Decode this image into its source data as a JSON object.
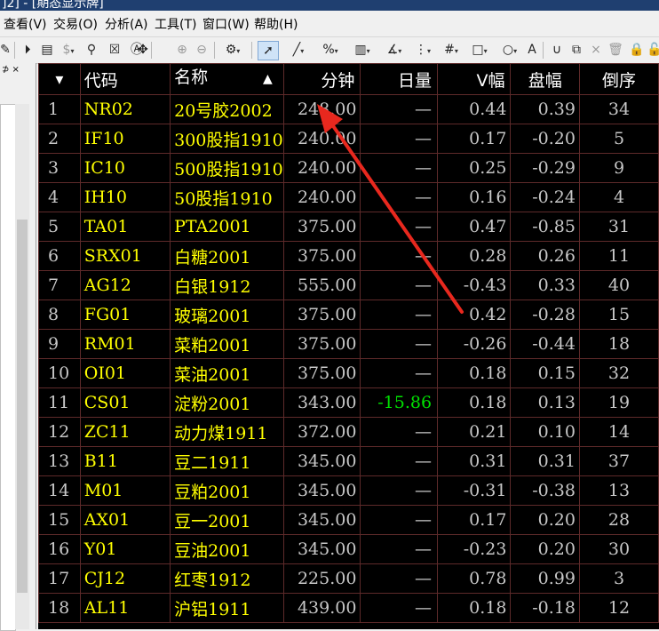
{
  "window": {
    "title_fragment": "]2] - [期态显示牌]"
  },
  "menu": [
    {
      "label": "查看(V)"
    },
    {
      "label": "交易(O)"
    },
    {
      "label": "分析(A)"
    },
    {
      "label": "工具(T)"
    },
    {
      "label": "窗口(W)"
    },
    {
      "label": "帮助(H)"
    }
  ],
  "left_panel": {
    "pin": "⊅ ×"
  },
  "table": {
    "columns": [
      "",
      "代码",
      "名称",
      "分钟",
      "日量",
      "V幅",
      "盘幅",
      "倒序"
    ],
    "sort_indicator": "▲",
    "menu_glyph": "▾",
    "rows": [
      {
        "idx": "1",
        "code": "NR02",
        "name": "20号胶2002",
        "minute": "248.00",
        "volume": "—",
        "vamp": "0.44",
        "pamp": "0.39",
        "rev": "34"
      },
      {
        "idx": "2",
        "code": "IF10",
        "name": "300股指1910",
        "minute": "240.00",
        "volume": "—",
        "vamp": "0.17",
        "pamp": "-0.20",
        "rev": "5"
      },
      {
        "idx": "3",
        "code": "IC10",
        "name": "500股指1910",
        "minute": "240.00",
        "volume": "—",
        "vamp": "0.25",
        "pamp": "-0.29",
        "rev": "9"
      },
      {
        "idx": "4",
        "code": "IH10",
        "name": "50股指1910",
        "minute": "240.00",
        "volume": "—",
        "vamp": "0.16",
        "pamp": "-0.24",
        "rev": "4"
      },
      {
        "idx": "5",
        "code": "TA01",
        "name": "PTA2001",
        "minute": "375.00",
        "volume": "—",
        "vamp": "0.47",
        "pamp": "-0.85",
        "rev": "31"
      },
      {
        "idx": "6",
        "code": "SRX01",
        "name": "白糖2001",
        "minute": "375.00",
        "volume": "—",
        "vamp": "0.28",
        "pamp": "0.26",
        "rev": "11"
      },
      {
        "idx": "7",
        "code": "AG12",
        "name": "白银1912",
        "minute": "555.00",
        "volume": "—",
        "vamp": "-0.43",
        "pamp": "0.33",
        "rev": "40"
      },
      {
        "idx": "8",
        "code": "FG01",
        "name": "玻璃2001",
        "minute": "375.00",
        "volume": "—",
        "vamp": "0.42",
        "pamp": "-0.28",
        "rev": "15"
      },
      {
        "idx": "9",
        "code": "RM01",
        "name": "菜粕2001",
        "minute": "375.00",
        "volume": "—",
        "vamp": "-0.26",
        "pamp": "-0.44",
        "rev": "18"
      },
      {
        "idx": "10",
        "code": "OI01",
        "name": "菜油2001",
        "minute": "375.00",
        "volume": "—",
        "vamp": "0.18",
        "pamp": "0.15",
        "rev": "32"
      },
      {
        "idx": "11",
        "code": "CS01",
        "name": "淀粉2001",
        "minute": "343.00",
        "volume": "-15.86",
        "vamp": "0.18",
        "pamp": "0.13",
        "rev": "19",
        "volume_color": "green"
      },
      {
        "idx": "12",
        "code": "ZC11",
        "name": "动力煤1911",
        "minute": "372.00",
        "volume": "—",
        "vamp": "0.21",
        "pamp": "0.10",
        "rev": "14"
      },
      {
        "idx": "13",
        "code": "B11",
        "name": "豆二1911",
        "minute": "345.00",
        "volume": "—",
        "vamp": "0.31",
        "pamp": "0.31",
        "rev": "37"
      },
      {
        "idx": "14",
        "code": "M01",
        "name": "豆粕2001",
        "minute": "345.00",
        "volume": "—",
        "vamp": "-0.31",
        "pamp": "-0.38",
        "rev": "13"
      },
      {
        "idx": "15",
        "code": "AX01",
        "name": "豆一2001",
        "minute": "345.00",
        "volume": "—",
        "vamp": "0.17",
        "pamp": "0.20",
        "rev": "28"
      },
      {
        "idx": "16",
        "code": "Y01",
        "name": "豆油2001",
        "minute": "345.00",
        "volume": "—",
        "vamp": "-0.23",
        "pamp": "0.20",
        "rev": "30"
      },
      {
        "idx": "17",
        "code": "CJ12",
        "name": "红枣1912",
        "minute": "225.00",
        "volume": "—",
        "vamp": "0.78",
        "pamp": "0.99",
        "rev": "3"
      },
      {
        "idx": "18",
        "code": "AL11",
        "name": "沪铝1911",
        "minute": "439.00",
        "volume": "—",
        "vamp": "0.18",
        "pamp": "-0.18",
        "rev": "12"
      }
    ]
  },
  "colors": {
    "grid_bg": "#000000",
    "grid_line": "#5e2a2a",
    "code_text": "#ffff00",
    "num_text": "#c8c8c8",
    "negative_volume": "#00e000",
    "annotation_arrow": "#e8281e"
  }
}
